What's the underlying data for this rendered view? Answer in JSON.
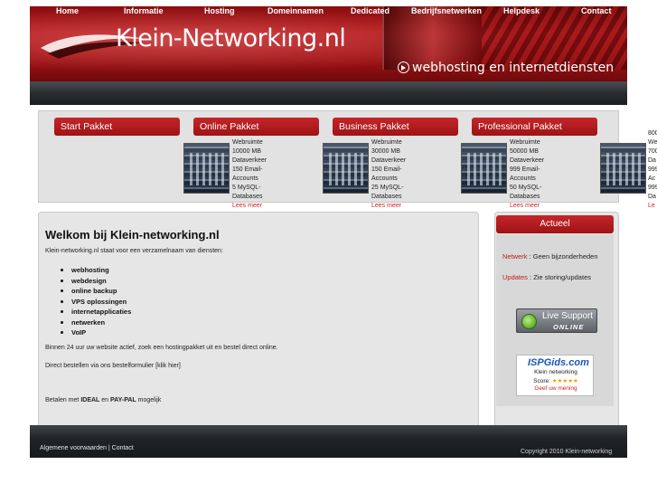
{
  "header": {
    "brand": "Klein-Networking.nl",
    "tagline": "webhosting en internetdiensten"
  },
  "nav": [
    "Home",
    "Informatie",
    "Hosting",
    "Domeinnamen",
    "Dedicated",
    "Bedrijfsnetwerken",
    "Helpdesk",
    "Contact"
  ],
  "packages": [
    {
      "title": "Start Pakket",
      "specs": []
    },
    {
      "title": "Online Pakket",
      "specs": [
        "Webruimte",
        "10000 MB",
        "Dataverkeer",
        "150 Email-",
        "Accounts",
        "5 MySQL-",
        "Databases"
      ],
      "more": "Lees meer"
    },
    {
      "title": "Business Pakket",
      "specs": [
        "Webruimte",
        "30000 MB",
        "Dataverkeer",
        "150 Email-",
        "Accounts",
        "25 MySQL-",
        "Databases"
      ],
      "more": "Lees meer"
    },
    {
      "title": "Professional Pakket",
      "specs": [
        "Webruimte",
        "50000 MB",
        "Dataverkeer",
        "999 Email-",
        "Accounts",
        "50 MySQL-",
        "Databases"
      ],
      "more": "Lees meer"
    }
  ],
  "package5_partial": [
    "800",
    "We",
    "700",
    "Da",
    "999",
    "Ac",
    "999",
    "Da",
    "Le"
  ],
  "main": {
    "heading": "Welkom bij Klein-networking.nl",
    "intro": "Klein-networking.nl staat voor een verzamelnaam van diensten:",
    "services": [
      "webhosting",
      "webdesign",
      "online backup",
      "VPS oplossingen",
      "internetapplicaties",
      "netwerken",
      "VoIP"
    ],
    "line1": "Binnen 24 uur uw website actief, zoek een hostingpakket uit en bestel direct online.",
    "line2": "Direct bestellen via ons bestelformulier [klik hier]",
    "pay_prefix": "Betalen met",
    "pay_ideal": "IDEAL",
    "pay_and": "en",
    "pay_paypal": "PAY-PAL",
    "pay_suffix": "mogelijk"
  },
  "sidebar": {
    "title": "Actueel",
    "network_key": "Netwerk",
    "network_val": ": Geen bijzonderheden",
    "updates_key": "Updates",
    "updates_val": ": Zie storing/updates",
    "live_support_1": "Live Support",
    "live_support_2": "ONLINE",
    "isp_logo": "ISPGids.com",
    "isp_name": "Klein networking",
    "isp_score_label": "Score:",
    "isp_stars": "★★★★★",
    "isp_rate": "Geef uw mening"
  },
  "footer": {
    "left": "Algemene voorwaarden | Contact",
    "right": "Copyright 2010 Klein-networking"
  },
  "colors": {
    "brand_red": "#b3181b",
    "nav_dark": "#2a2d30",
    "link_red": "#c22222"
  }
}
